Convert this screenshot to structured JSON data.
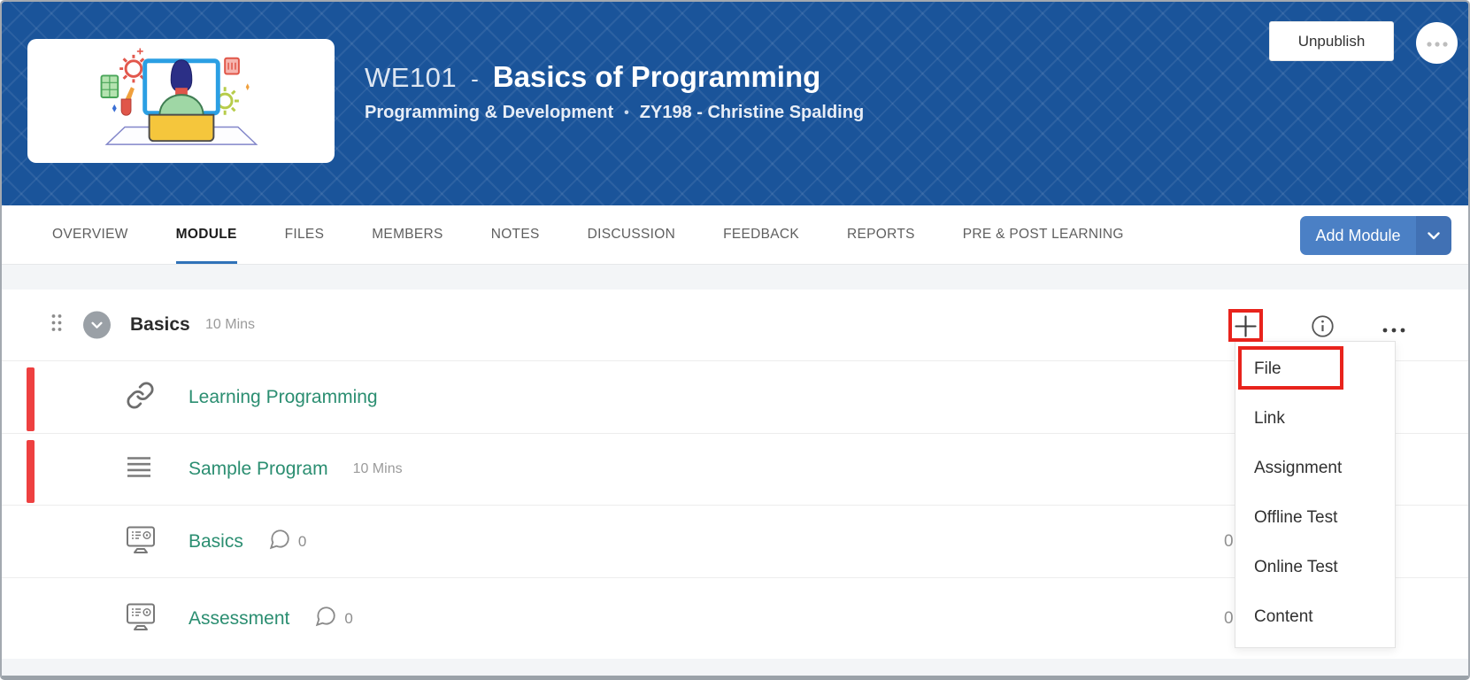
{
  "hero": {
    "course_code": "WE101",
    "dash": "-",
    "course_title": "Basics of Programming",
    "category": "Programming & Development",
    "dot": "•",
    "instructor": "ZY198 - Christine Spalding",
    "unpublish_label": "Unpublish",
    "thumbnail_icon": "person-at-computer-illustration",
    "more_icon": "ellipsis-icon",
    "background_color": "#1a549a"
  },
  "tabs": [
    {
      "label": "OVERVIEW",
      "active": false
    },
    {
      "label": "MODULE",
      "active": true
    },
    {
      "label": "FILES",
      "active": false
    },
    {
      "label": "MEMBERS",
      "active": false
    },
    {
      "label": "NOTES",
      "active": false
    },
    {
      "label": "DISCUSSION",
      "active": false
    },
    {
      "label": "FEEDBACK",
      "active": false
    },
    {
      "label": "REPORTS",
      "active": false
    },
    {
      "label": "PRE & POST LEARNING",
      "active": false
    }
  ],
  "toolbar": {
    "add_module_label": "Add Module",
    "chevron_icon": "chevron-down-icon"
  },
  "module": {
    "title": "Basics",
    "duration": "10 Mins",
    "drag_icon": "drag-handle-icon",
    "collapse_icon": "chevron-down-icon",
    "add_icon": "plus-icon",
    "info_icon": "info-icon",
    "more_icon": "ellipsis-icon"
  },
  "items": [
    {
      "title": "Learning Programming",
      "icon": "link-icon",
      "flagged": true
    },
    {
      "title": "Sample Program",
      "icon": "lines-icon",
      "duration": "10 Mins",
      "flagged": true
    },
    {
      "title": "Basics",
      "icon": "online-test-icon",
      "comments": "0",
      "right_value": "0",
      "flagged": false
    },
    {
      "title": "Assessment",
      "icon": "online-test-icon",
      "comments": "0",
      "right_value": "0",
      "flagged": false
    }
  ],
  "add_menu": {
    "items": [
      "File",
      "Link",
      "Assignment",
      "Offline Test",
      "Online Test",
      "Content"
    ],
    "highlighted_item": "File"
  },
  "colors": {
    "header_blue": "#1a549a",
    "button_blue": "#4b80c5",
    "active_tab_blue": "#2f72b8",
    "link_green": "#2b8e71",
    "flag_red": "#ee4040",
    "annotation_red": "#e8231c"
  }
}
